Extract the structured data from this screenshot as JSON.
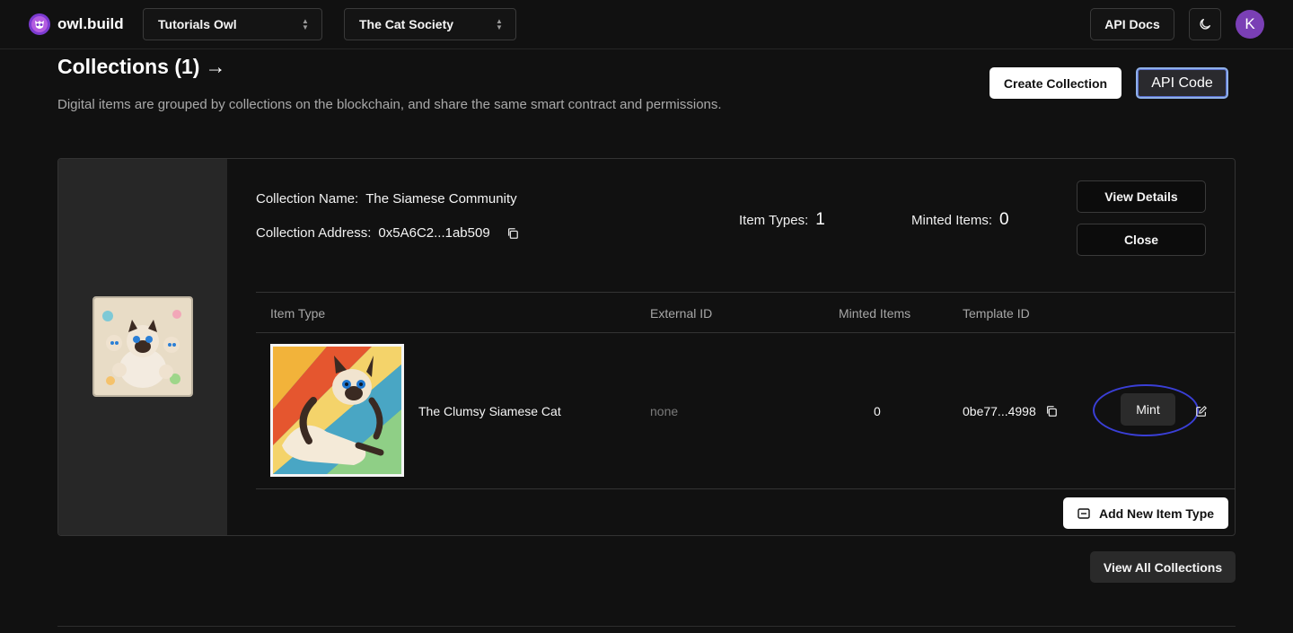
{
  "brand": {
    "name": "owl.build"
  },
  "topbar": {
    "org_select": "Tutorials Owl",
    "project_select": "The Cat Society",
    "api_docs_label": "API Docs",
    "theme_icon": "moon-icon",
    "avatar_initial": "K"
  },
  "header": {
    "title": "Collections (1)",
    "arrow": "→",
    "description": "Digital items are grouped by collections on the blockchain, and share the same smart contract and permissions.",
    "create_label": "Create Collection",
    "api_code_label": "API Code"
  },
  "collection": {
    "name_label": "Collection Name:",
    "name": "The Siamese Community",
    "address_label": "Collection Address:",
    "address": "0x5A6C2...1ab509",
    "item_types_label": "Item Types:",
    "item_types": "1",
    "minted_items_label": "Minted Items:",
    "minted_items": "0",
    "view_details_label": "View Details",
    "close_label": "Close"
  },
  "table": {
    "headers": [
      "Item Type",
      "External ID",
      "Minted Items",
      "Template ID"
    ],
    "rows": [
      {
        "name": "The Clumsy Siamese Cat",
        "external_id": "none",
        "minted": "0",
        "template_id": "0be77...4998",
        "mint_label": "Mint"
      }
    ]
  },
  "actions": {
    "add_item_type_label": "Add New Item Type",
    "view_all_label": "View All Collections"
  },
  "colors": {
    "background": "#111111",
    "accent_ring": "#3a3fd6",
    "avatar": "#7a3fb5"
  }
}
